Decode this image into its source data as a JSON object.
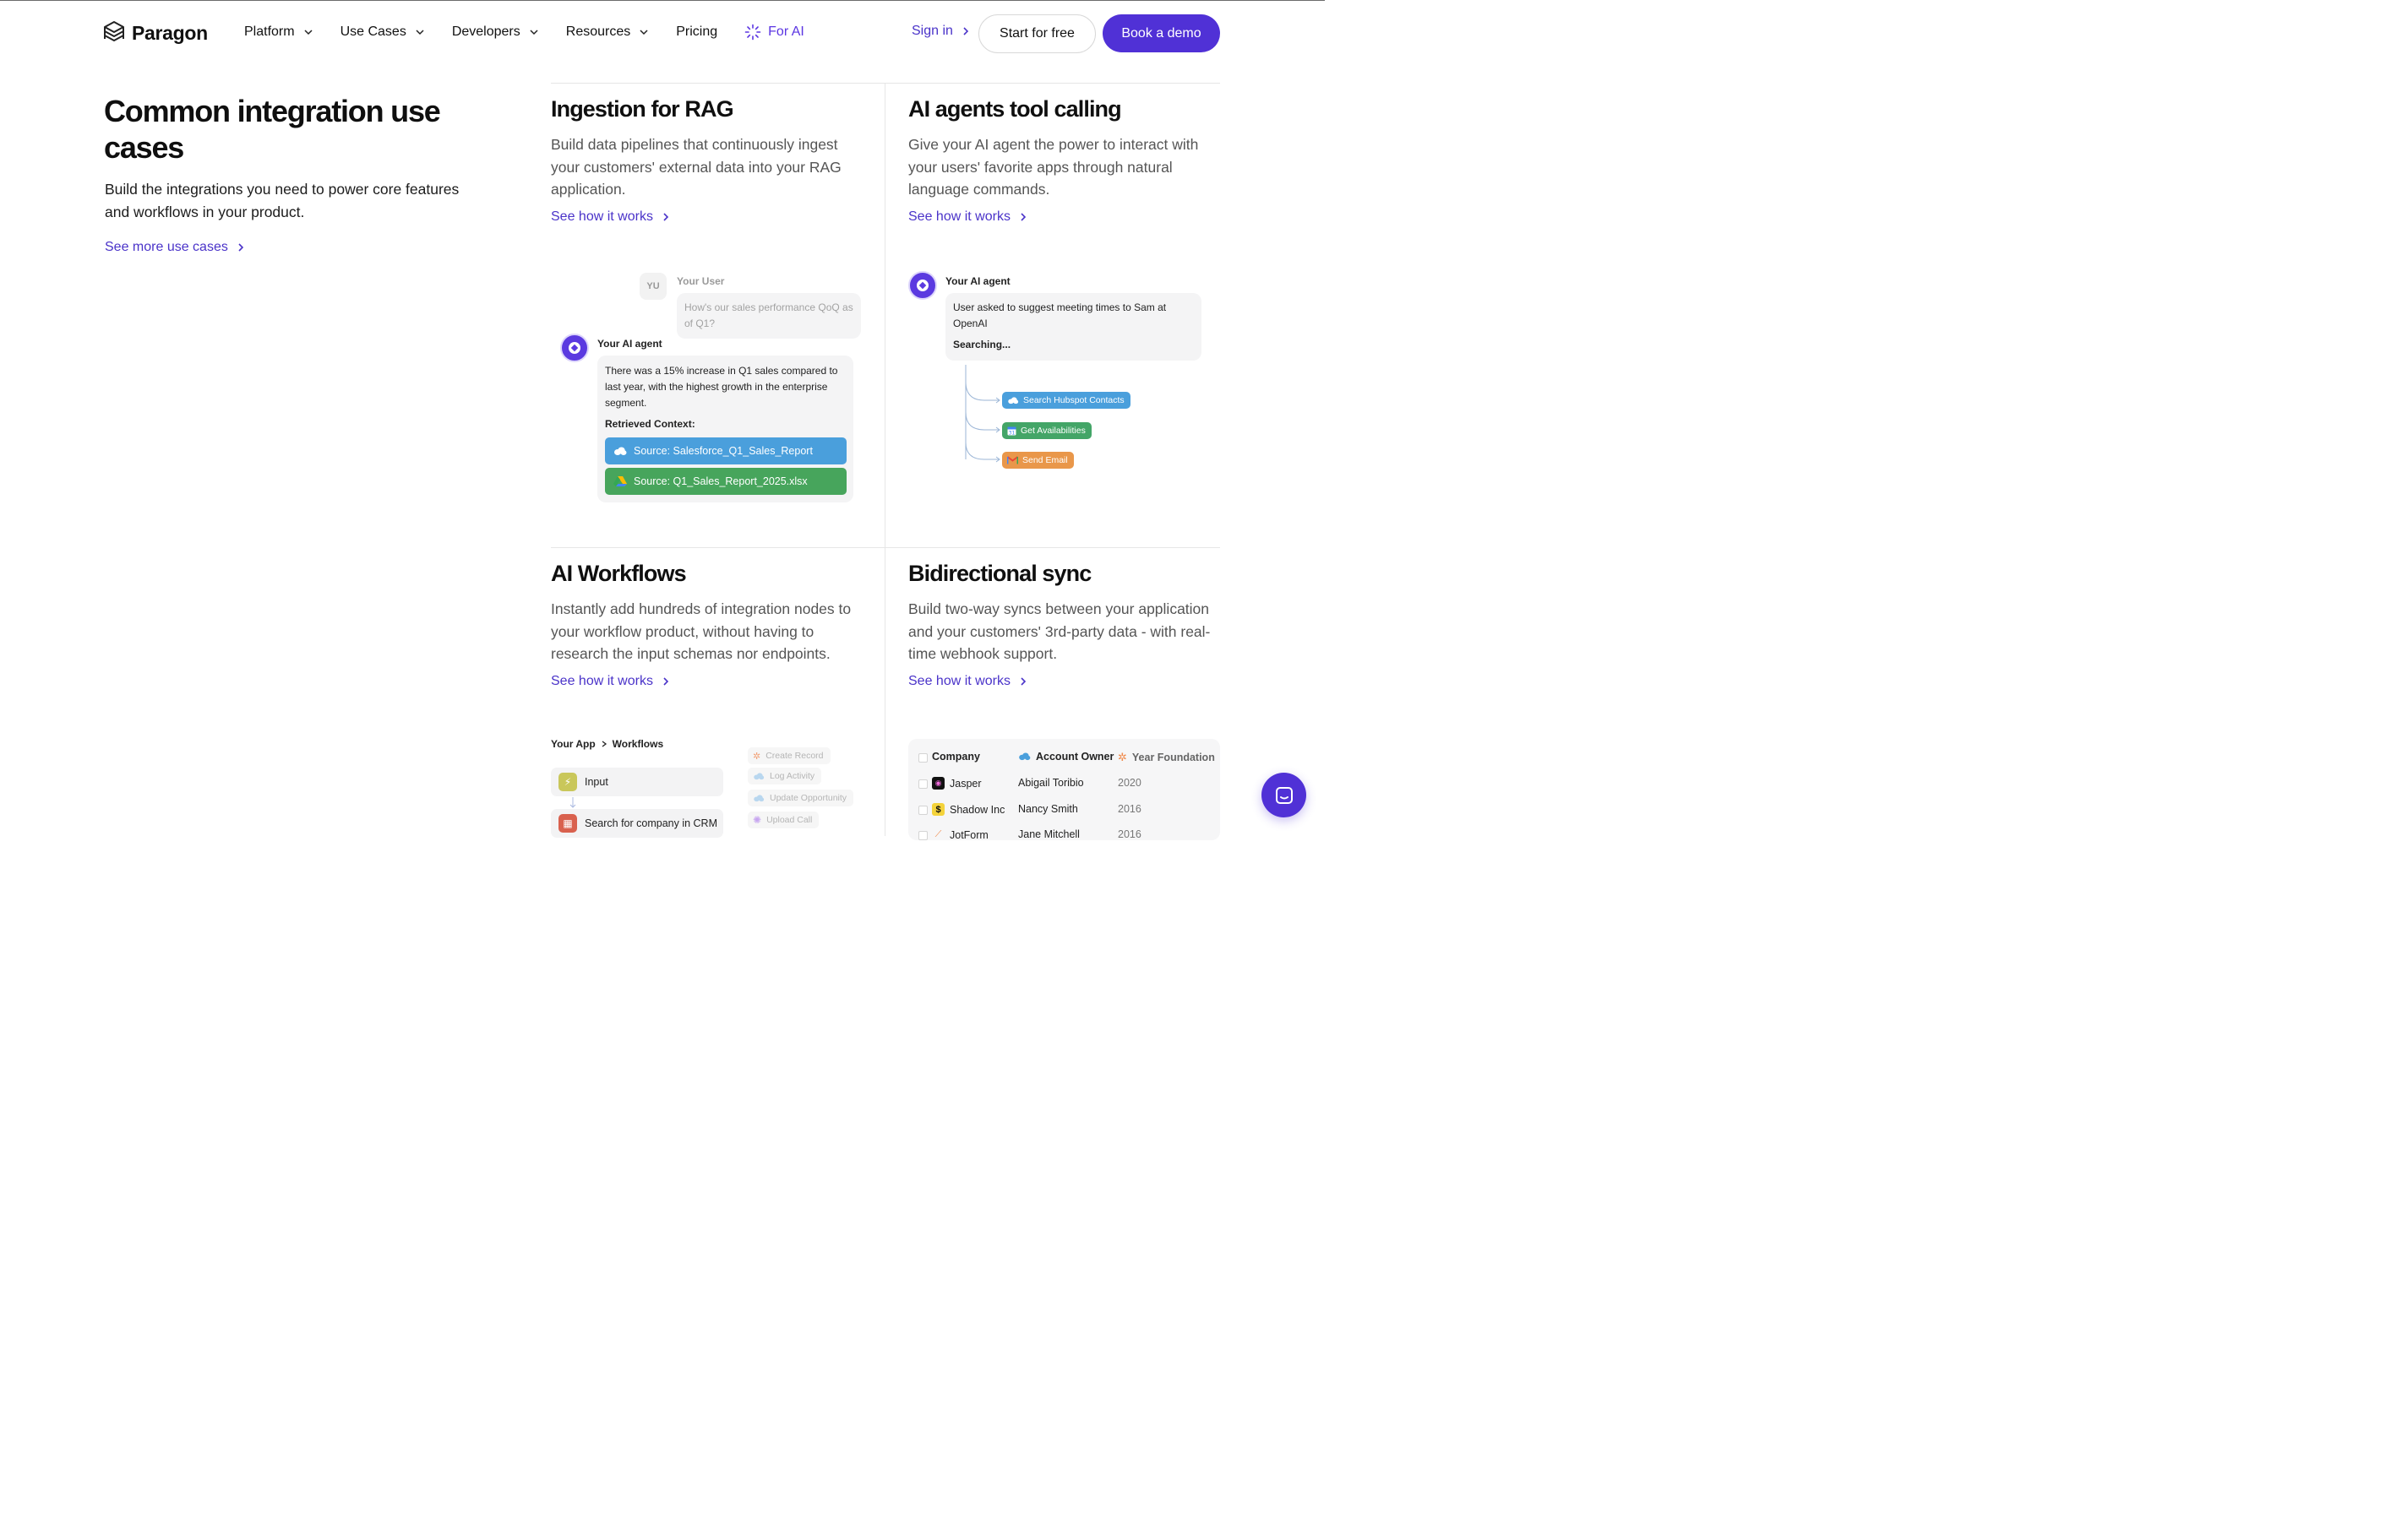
{
  "nav": {
    "logo": "Paragon",
    "items": [
      {
        "label": "Platform",
        "dropdown": true
      },
      {
        "label": "Use Cases",
        "dropdown": true
      },
      {
        "label": "Developers",
        "dropdown": true
      },
      {
        "label": "Resources",
        "dropdown": true
      },
      {
        "label": "Pricing",
        "dropdown": false
      }
    ],
    "ai_label": "For AI",
    "sign_in": "Sign in",
    "start_free": "Start for free",
    "book_demo": "Book a demo"
  },
  "intro": {
    "title": "Common integration use cases",
    "description": "Build the integrations you need to power core features and workflows in your product.",
    "link": "See more use cases"
  },
  "cards": {
    "rag": {
      "title": "Ingestion for RAG",
      "description": "Build data pipelines that continuously ingest your customers' external data into your RAG application.",
      "link": "See how it works",
      "mock": {
        "user_initials": "YU",
        "user_label": "Your User",
        "user_message": "How's our sales performance QoQ as of Q1?",
        "agent_label": "Your AI agent",
        "agent_message": "There was a 15% increase in Q1 sales compared to last year, with the highest growth in the enterprise segment.",
        "context_label": "Retrieved Context:",
        "source_1": "Source: Salesforce_Q1_Sales_Report",
        "source_2": "Source: Q1_Sales_Report_2025.xlsx"
      }
    },
    "agents": {
      "title": "AI agents tool calling",
      "description": "Give your AI agent the power to interact with your users' favorite apps through natural language commands.",
      "link": "See how it works",
      "mock": {
        "agent_label": "Your AI agent",
        "message": "User asked to suggest meeting times to Sam at OpenAI",
        "status": "Searching...",
        "tools": [
          "Search Hubspot Contacts",
          "Get Availabilities",
          "Send Email"
        ]
      }
    },
    "workflows": {
      "title": "AI Workflows",
      "description": "Instantly add hundreds of integration nodes to your workflow product, without having to research the input schemas nor endpoints.",
      "link": "See how it works",
      "mock": {
        "crumb_app": "Your App",
        "crumb_section": "Workflows",
        "node_1": "Input",
        "node_2": "Search for company in CRM",
        "ghost_actions": [
          "Create Record",
          "Log Activity",
          "Update Opportunity",
          "Upload Call"
        ]
      }
    },
    "sync": {
      "title": "Bidirectional sync",
      "description": "Build two-way syncs between your application and your customers' 3rd-party data - with real-time webhook support.",
      "link": "See how it works",
      "mock": {
        "headers": [
          "Company",
          "Account Owner",
          "Year Foundation"
        ],
        "rows": [
          {
            "company": "Jasper",
            "owner": "Abigail Toribio",
            "year": "2020"
          },
          {
            "company": "Shadow Inc",
            "owner": "Nancy Smith",
            "year": "2016"
          },
          {
            "company": "JotForm",
            "owner": "Jane Mitchell",
            "year": "2016"
          }
        ]
      }
    }
  },
  "colors": {
    "brand": "#5031d6",
    "link": "#4a33c9",
    "salesforce": "#4a9fdc",
    "sheets": "#47a55c",
    "orange": "#e9974a",
    "green_pill": "#43a567"
  }
}
